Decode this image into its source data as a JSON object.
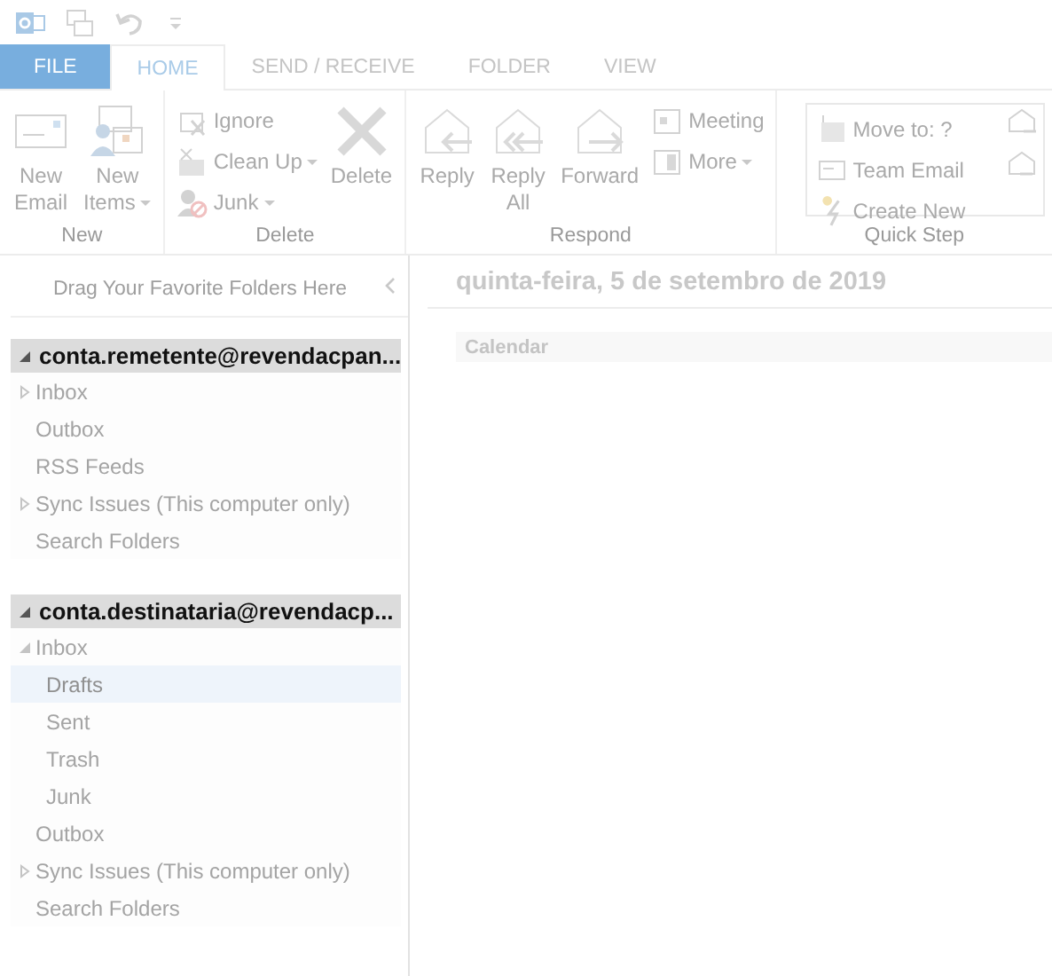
{
  "tabs": [
    {
      "label": "FILE",
      "kind": "file",
      "selected": false
    },
    {
      "label": "HOME",
      "kind": "tab",
      "selected": true
    },
    {
      "label": "SEND / RECEIVE",
      "kind": "tab",
      "selected": false
    },
    {
      "label": "FOLDER",
      "kind": "tab",
      "selected": false
    },
    {
      "label": "VIEW",
      "kind": "tab",
      "selected": false
    }
  ],
  "ribbon": {
    "groups": [
      {
        "label": "New",
        "kind": "normal",
        "buttons": [
          {
            "label": "New\nEmail",
            "kind": "large",
            "dropdown": false
          },
          {
            "label": "New\nItems",
            "kind": "large",
            "dropdown": true
          }
        ]
      },
      {
        "label": "Delete",
        "kind": "normal",
        "buttons": [
          {
            "label": "Ignore",
            "kind": "small",
            "dropdown": false
          },
          {
            "label": "Clean Up",
            "kind": "small",
            "dropdown": true
          },
          {
            "label": "Junk",
            "kind": "small",
            "dropdown": true
          },
          {
            "label": "Delete",
            "kind": "large",
            "dropdown": false
          }
        ]
      },
      {
        "label": "Respond",
        "kind": "normal",
        "buttons": [
          {
            "label": "Reply",
            "kind": "large",
            "dropdown": false
          },
          {
            "label": "Reply\nAll",
            "kind": "large",
            "dropdown": false
          },
          {
            "label": "Forward",
            "kind": "large",
            "dropdown": false
          },
          {
            "label": "Meeting",
            "kind": "small",
            "dropdown": false
          },
          {
            "label": "More",
            "kind": "small",
            "dropdown": true
          }
        ]
      },
      {
        "label": "Quick Step",
        "kind": "quick",
        "buttons": [
          {
            "label": "Move to: ?",
            "kind": "small",
            "dropdown": false
          },
          {
            "label": "Team Email",
            "kind": "small",
            "dropdown": false
          },
          {
            "label": "Create New",
            "kind": "small",
            "dropdown": false
          }
        ]
      }
    ]
  },
  "folder_pane": {
    "favorites_hint": "Drag Your Favorite Folders Here",
    "accounts": [
      {
        "name": "conta.remetente@revendacpan...",
        "expanded": true,
        "folders": [
          {
            "name": "Inbox",
            "expandable": true,
            "expanded": false,
            "selected": false
          },
          {
            "name": "Outbox",
            "selected": false
          },
          {
            "name": "RSS Feeds",
            "selected": false
          },
          {
            "name": "Sync Issues (This computer only)",
            "expandable": true,
            "expanded": false,
            "selected": false
          },
          {
            "name": "Search Folders",
            "selected": false
          }
        ]
      },
      {
        "name": "conta.destinataria@revendacp...",
        "expanded": true,
        "folders": [
          {
            "name": "Inbox",
            "expandable": true,
            "expanded": true,
            "selected": false,
            "children": [
              {
                "name": "Drafts",
                "selected": true
              },
              {
                "name": "Sent",
                "selected": false
              },
              {
                "name": "Trash",
                "selected": false
              },
              {
                "name": "Junk",
                "selected": false
              }
            ]
          },
          {
            "name": "Outbox",
            "selected": false
          },
          {
            "name": "Sync Issues (This computer only)",
            "expandable": true,
            "expanded": false,
            "selected": false
          },
          {
            "name": "Search Folders",
            "selected": false
          }
        ]
      }
    ]
  },
  "main": {
    "date": "quinta-feira, 5 de setembro de 2019",
    "calendar_header": "Calendar"
  }
}
